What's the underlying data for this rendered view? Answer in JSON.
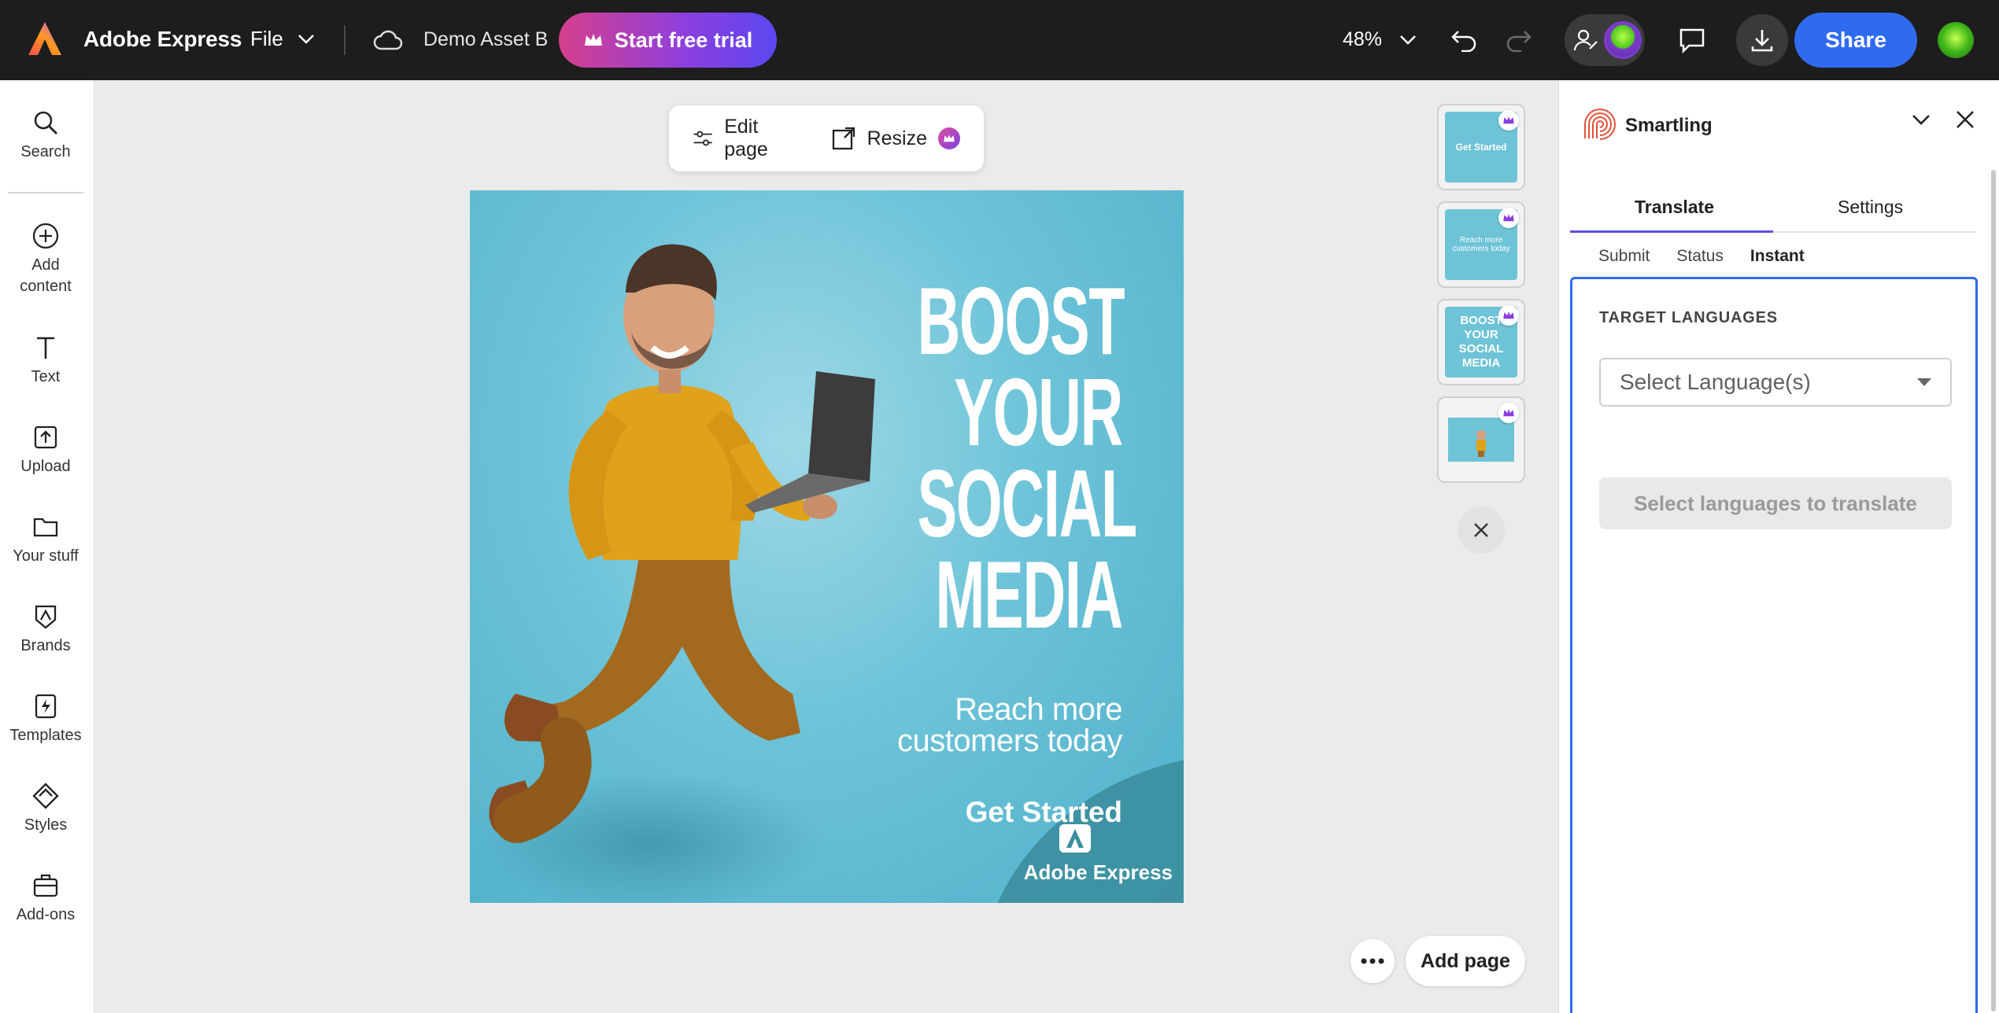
{
  "app": {
    "name": "Adobe Express",
    "file_label": "File",
    "document_name": "Demo Asset B",
    "trial_label": "Start free trial",
    "zoom": "48%",
    "share_label": "Share"
  },
  "leftrail": {
    "items": [
      {
        "label": "Search",
        "icon": "search-icon"
      },
      {
        "label": "Add\ncontent",
        "icon": "add-icon"
      },
      {
        "label": "Text",
        "icon": "text-icon"
      },
      {
        "label": "Upload",
        "icon": "upload-icon"
      },
      {
        "label": "Your stuff",
        "icon": "folder-icon"
      },
      {
        "label": "Brands",
        "icon": "brand-icon"
      },
      {
        "label": "Templates",
        "icon": "templates-icon"
      },
      {
        "label": "Styles",
        "icon": "styles-icon"
      },
      {
        "label": "Add-ons",
        "icon": "addons-icon"
      }
    ]
  },
  "canvas_toolbar": {
    "edit_page": "Edit page",
    "resize": "Resize"
  },
  "artboard": {
    "headline": [
      "BOOST",
      "YOUR",
      "SOCIAL",
      "MEDIA"
    ],
    "subline_1": "Reach more",
    "subline_2": "customers today",
    "cta": "Get Started",
    "brand": "Adobe Express"
  },
  "thumbnails": [
    {
      "text": "Get Started"
    },
    {
      "text": "Reach more customers today"
    },
    {
      "text": "BOOST YOUR SOCIAL MEDIA"
    },
    {
      "text": ""
    }
  ],
  "bottom": {
    "add_page": "Add page"
  },
  "panel": {
    "title": "Smartling",
    "tabs": [
      "Translate",
      "Settings"
    ],
    "subtabs": [
      "Submit",
      "Status",
      "Instant"
    ],
    "target_languages_label": "TARGET LANGUAGES",
    "language_placeholder": "Select Language(s)",
    "translate_button": "Select languages to translate"
  },
  "colors": {
    "accent": "#2f6bf0",
    "topbar": "#1d1d1d",
    "tab_indicator": "#5b4fe0",
    "artboard_bg": "#6cc3d8"
  }
}
